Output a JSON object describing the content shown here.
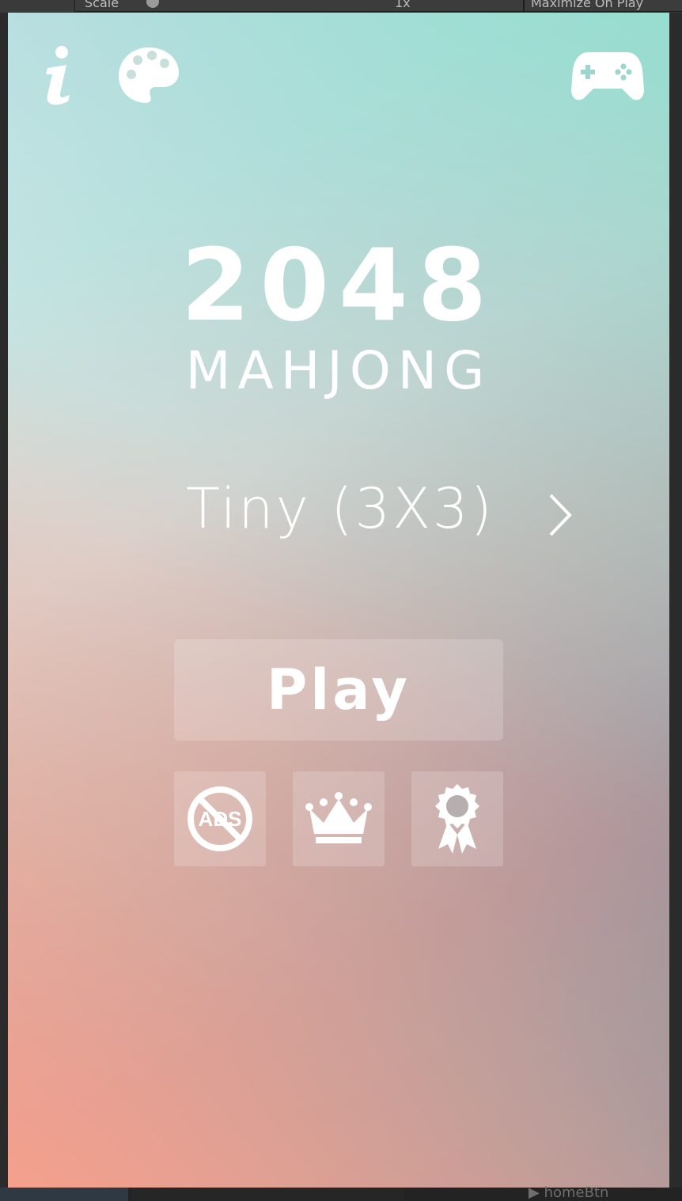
{
  "editor": {
    "top_left_label": "Scale",
    "top_mid_label": "1x",
    "top_right_label": "Maximize On Play",
    "bottom_label": "homeBtn"
  },
  "game": {
    "title_number": "2048",
    "title_subtitle": "MAHJONG",
    "board_size_label": "Tiny (3X3)",
    "play_label": "Play",
    "icons": {
      "info": "info-icon",
      "palette": "palette-icon",
      "games": "gamepad-icon",
      "next": "chevron-right-icon",
      "no_ads": "no-ads-icon",
      "leaderboard": "crown-icon",
      "achievements": "award-ribbon-icon"
    },
    "no_ads_text": "ADS"
  }
}
